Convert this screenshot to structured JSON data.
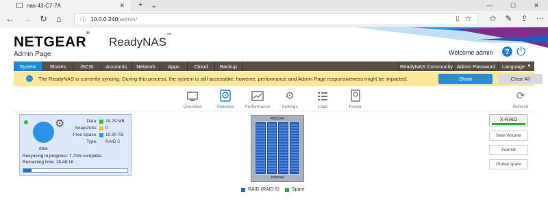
{
  "browser": {
    "tab_title": "nas-43-C7-7A",
    "url_host": "10.0.0.240",
    "url_path": "/admin/"
  },
  "header": {
    "brand": "NETGEAR",
    "product": "ReadyNAS",
    "page_label": "Admin Page",
    "welcome": "Welcome admin"
  },
  "nav": {
    "items": [
      "System",
      "Shares",
      "iSCSI",
      "Accounts",
      "Network",
      "Apps",
      "Cloud",
      "Backup"
    ],
    "right_items": [
      "ReadyNAS Community",
      "Admin Password",
      "Language"
    ],
    "active_color": "#1d88d6",
    "bar_color": "#5a4e45"
  },
  "notification": {
    "message": "The ReadyNAS is currently syncing. During this process, the system is still accessible; however, performance and Admin Page responsiveness might be impacted.",
    "show_label": "Show",
    "clear_label": "Clear All"
  },
  "subnav": {
    "items": [
      "Overview",
      "Volumes",
      "Performance",
      "Settings",
      "Logs",
      "Power"
    ],
    "active": "Volumes",
    "refresh": "Refresh"
  },
  "volume": {
    "name": "data",
    "data_label": "Data:",
    "data_value": "19.29 MB",
    "snapshots_label": "Snapshots:",
    "snapshots_value": "0",
    "free_label": "Free Space:",
    "free_value": "10.90 TB",
    "type_label": "Type:",
    "type_value": "RAID 5",
    "resync_text": "Resyncing in progress: 7.73% complete.",
    "remaining_text": "Remaining time: 18:48:16",
    "progress_fraction": 0.0773,
    "colors": {
      "data": "#2fbf2f",
      "snapshots": "#f2c21b",
      "free": "#2b93e6"
    }
  },
  "nas": {
    "model": "RN524X",
    "enclosure": "Internal"
  },
  "legend": {
    "raid": "RAID (RAID 5)",
    "spare": "Spare",
    "raid_color": "#2d67c9",
    "spare_color": "#2fb52f"
  },
  "actions": {
    "xraid": "X-RAID",
    "new_volume": "New Volume",
    "format": "Format",
    "global_spare": "Global spare"
  }
}
